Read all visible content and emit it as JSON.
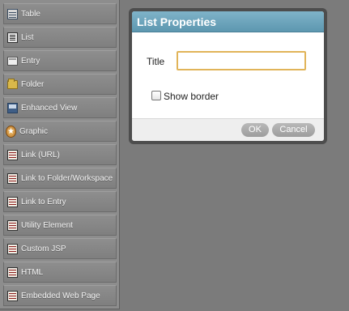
{
  "palette": {
    "items": [
      {
        "label": "Table",
        "icon": "table-icon"
      },
      {
        "label": "List",
        "icon": "list-icon"
      },
      {
        "label": "Entry",
        "icon": "entry-icon"
      },
      {
        "label": "Folder",
        "icon": "folder-icon"
      },
      {
        "label": "Enhanced View",
        "icon": "enhanced-view-icon"
      },
      {
        "label": "Graphic",
        "icon": "graphic-icon"
      },
      {
        "label": "Link (URL)",
        "icon": "link-url-icon"
      },
      {
        "label": "Link to Folder/Workspace",
        "icon": "link-folder-icon"
      },
      {
        "label": "Link to Entry",
        "icon": "link-entry-icon"
      },
      {
        "label": "Utility Element",
        "icon": "utility-element-icon"
      },
      {
        "label": "Custom JSP",
        "icon": "custom-jsp-icon"
      },
      {
        "label": "HTML",
        "icon": "html-icon"
      },
      {
        "label": "Embedded Web Page",
        "icon": "embedded-web-page-icon"
      }
    ]
  },
  "dialog": {
    "title": "List Properties",
    "title_field": {
      "label": "Title",
      "value": ""
    },
    "show_border": {
      "label": "Show border",
      "checked": false
    },
    "ok_label": "OK",
    "cancel_label": "Cancel"
  },
  "colors": {
    "header": "#6aa3bb",
    "input_focus": "#e1b459",
    "background": "#7b7b7b"
  }
}
